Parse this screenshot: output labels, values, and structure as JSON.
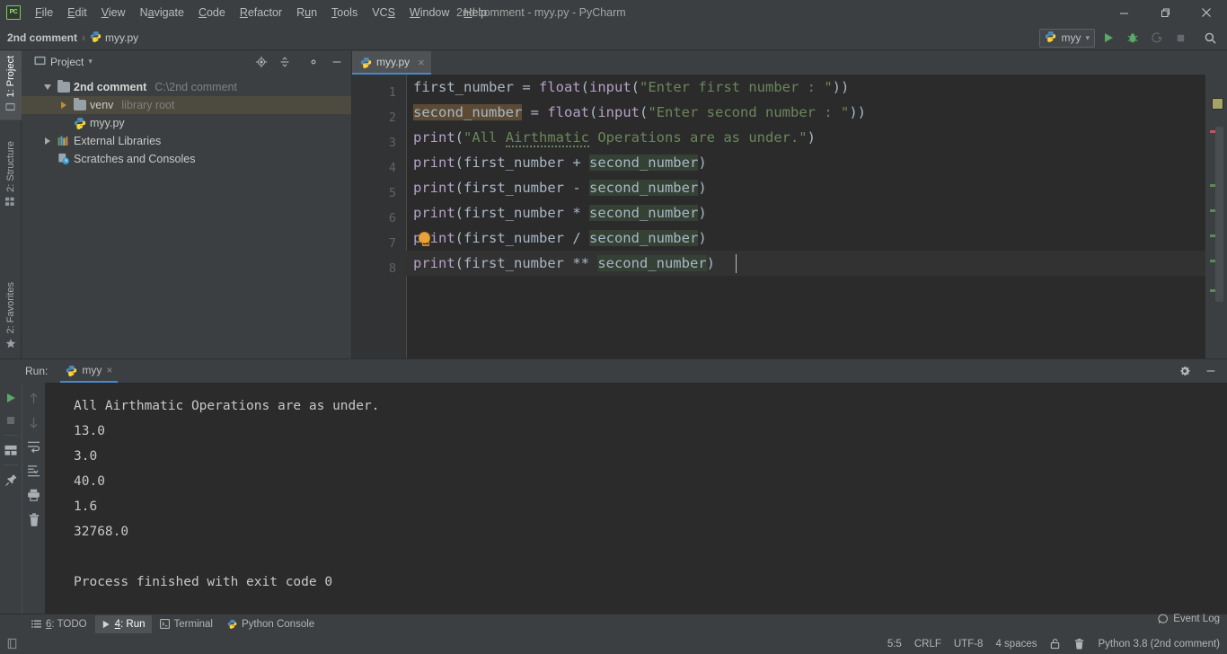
{
  "window": {
    "title": "2nd comment - myy.py - PyCharm",
    "app_icon": "pycharm-logo-icon",
    "minimize_label": "Minimize",
    "restore_label": "Restore",
    "close_label": "Close"
  },
  "menu": {
    "items": [
      {
        "label": "File",
        "mnemonic": "F"
      },
      {
        "label": "Edit",
        "mnemonic": "E"
      },
      {
        "label": "View",
        "mnemonic": "V"
      },
      {
        "label": "Navigate",
        "mnemonic": "a"
      },
      {
        "label": "Code",
        "mnemonic": "C"
      },
      {
        "label": "Refactor",
        "mnemonic": "R"
      },
      {
        "label": "Run",
        "mnemonic": "u"
      },
      {
        "label": "Tools",
        "mnemonic": "T"
      },
      {
        "label": "VCS",
        "mnemonic": "S"
      },
      {
        "label": "Window",
        "mnemonic": "W"
      },
      {
        "label": "Help",
        "mnemonic": "H"
      }
    ]
  },
  "navbar": {
    "breadcrumb_project": "2nd comment",
    "breadcrumb_separator": "›",
    "breadcrumb_file": "myy.py",
    "run_config": "myy",
    "run_config_caret": "▾",
    "buttons": [
      {
        "name": "run-button",
        "label": "Run"
      },
      {
        "name": "debug-button",
        "label": "Debug"
      },
      {
        "name": "run-with-coverage-button",
        "label": "Run with Coverage"
      },
      {
        "name": "stop-button",
        "label": "Stop"
      },
      {
        "name": "search-everywhere-button",
        "label": "Search Everywhere"
      }
    ]
  },
  "left_rail": {
    "tabs": [
      {
        "label": "1: Project",
        "active": true,
        "icon": "project-icon"
      },
      {
        "label": "2: Structure",
        "active": false,
        "icon": "structure-icon"
      }
    ],
    "bottom_tabs": [
      {
        "label": "2: Favorites",
        "active": false,
        "icon": "star-icon"
      }
    ]
  },
  "project_panel": {
    "title": "Project",
    "title_caret": "▾",
    "tools": [
      {
        "name": "select-opened-file-button",
        "label": "Select Opened File"
      },
      {
        "name": "collapse-all-button",
        "label": "Collapse All"
      },
      {
        "name": "settings-button",
        "label": "Settings"
      },
      {
        "name": "hide-button",
        "label": "Hide"
      }
    ],
    "tree": [
      {
        "label": "2nd comment",
        "hint": "C:\\2nd comment",
        "icon": "folder-icon",
        "indent": 0,
        "expanded": true,
        "bold": true,
        "selected": false
      },
      {
        "label": "venv",
        "hint": "library root",
        "icon": "folder-icon",
        "indent": 1,
        "expanded": false,
        "bold": false,
        "selected": true
      },
      {
        "label": "myy.py",
        "hint": "",
        "icon": "python-file-icon",
        "indent": 2,
        "expanded": null,
        "bold": false,
        "selected": false
      },
      {
        "label": "External Libraries",
        "hint": "",
        "icon": "libraries-icon",
        "indent": 0,
        "expanded": false,
        "bold": false,
        "selected": false
      },
      {
        "label": "Scratches and Consoles",
        "hint": "",
        "icon": "scratches-icon",
        "indent": 0,
        "expanded": null,
        "bold": false,
        "selected": false
      }
    ]
  },
  "editor": {
    "tabs": [
      {
        "label": "myy.py",
        "icon": "python-file-icon",
        "active": true,
        "close": "×"
      }
    ],
    "line_numbers": [
      "1",
      "2",
      "3",
      "4",
      "5",
      "6",
      "7",
      "8"
    ],
    "lines": [
      {
        "n": 1,
        "text": "first_number = float(input(\"Enter first number : \"))"
      },
      {
        "n": 2,
        "text": "second_number = float(input(\"Enter second number : \"))"
      },
      {
        "n": 3,
        "text": "print(\"All Airthmatic Operations are as under.\")"
      },
      {
        "n": 4,
        "text": "print(first_number + second_number)"
      },
      {
        "n": 5,
        "text": "print(first_number - second_number)"
      },
      {
        "n": 6,
        "text": "print(first_number * second_number)"
      },
      {
        "n": 7,
        "text": "print(first_number / second_number)"
      },
      {
        "n": 8,
        "text": "print(first_number ** second_number)"
      }
    ],
    "current_line": 8,
    "intention_bulb_line": 7,
    "typo_word": "Airthmatic",
    "colors": {
      "background": "#2b2b2b",
      "gutter": "#313335",
      "default_text": "#a9b7c6",
      "string": "#6a8759",
      "function": "#b5a0c8",
      "caret_identifier_highlight": "#5b4b35",
      "usage_highlight": "#344134",
      "current_line": "#323232",
      "accent": "#4a88c7"
    }
  },
  "run_window": {
    "label": "Run:",
    "tab": {
      "label": "myy",
      "icon": "python-file-icon",
      "close": "×",
      "active": true
    },
    "header_buttons": [
      {
        "name": "run-settings-button",
        "label": "Settings"
      },
      {
        "name": "hide-run-window-button",
        "label": "Hide"
      }
    ],
    "toolbar_left": [
      {
        "name": "rerun-button",
        "label": "Rerun",
        "enabled": true
      },
      {
        "name": "stop-process-button",
        "label": "Stop",
        "enabled": false
      },
      {
        "name": "layout-settings-button",
        "label": "Layout Settings",
        "enabled": true
      },
      {
        "name": "pin-tab-button",
        "label": "Pin Tab",
        "enabled": true
      }
    ],
    "toolbar_right": [
      {
        "name": "up-arrow-button",
        "label": "Up the Stack Trace",
        "enabled": false
      },
      {
        "name": "down-arrow-button",
        "label": "Down the Stack Trace",
        "enabled": false
      },
      {
        "name": "soft-wrap-button",
        "label": "Use Soft Wraps",
        "enabled": true
      },
      {
        "name": "scroll-to-end-button",
        "label": "Scroll to End",
        "enabled": true
      },
      {
        "name": "print-button",
        "label": "Print",
        "enabled": true
      },
      {
        "name": "clear-all-button",
        "label": "Clear All",
        "enabled": true
      }
    ],
    "console_output": [
      "All Airthmatic Operations are as under.",
      "13.0",
      "3.0",
      "40.0",
      "1.6",
      "32768.0",
      "",
      "Process finished with exit code 0"
    ]
  },
  "tool_strip": {
    "items": [
      {
        "label": "6: TODO",
        "mnemonic": "6",
        "icon": "todo-icon",
        "active": false
      },
      {
        "label": "4: Run",
        "mnemonic": "4",
        "icon": "run-icon",
        "active": true
      },
      {
        "label": "Terminal",
        "mnemonic": "",
        "icon": "terminal-icon",
        "active": false
      },
      {
        "label": "Python Console",
        "mnemonic": "",
        "icon": "python-console-icon",
        "active": false
      }
    ]
  },
  "status_bar": {
    "event_log": "Event Log",
    "event_log_icon": "balloon-icon",
    "caret_position": "5:5",
    "line_separator": "CRLF",
    "encoding": "UTF-8",
    "indent": "4 spaces",
    "lock_icon": "lock-icon",
    "trash_icon": "trash-icon",
    "interpreter": "Python 3.8 (2nd comment)",
    "layout_icon": "layout-icon"
  }
}
